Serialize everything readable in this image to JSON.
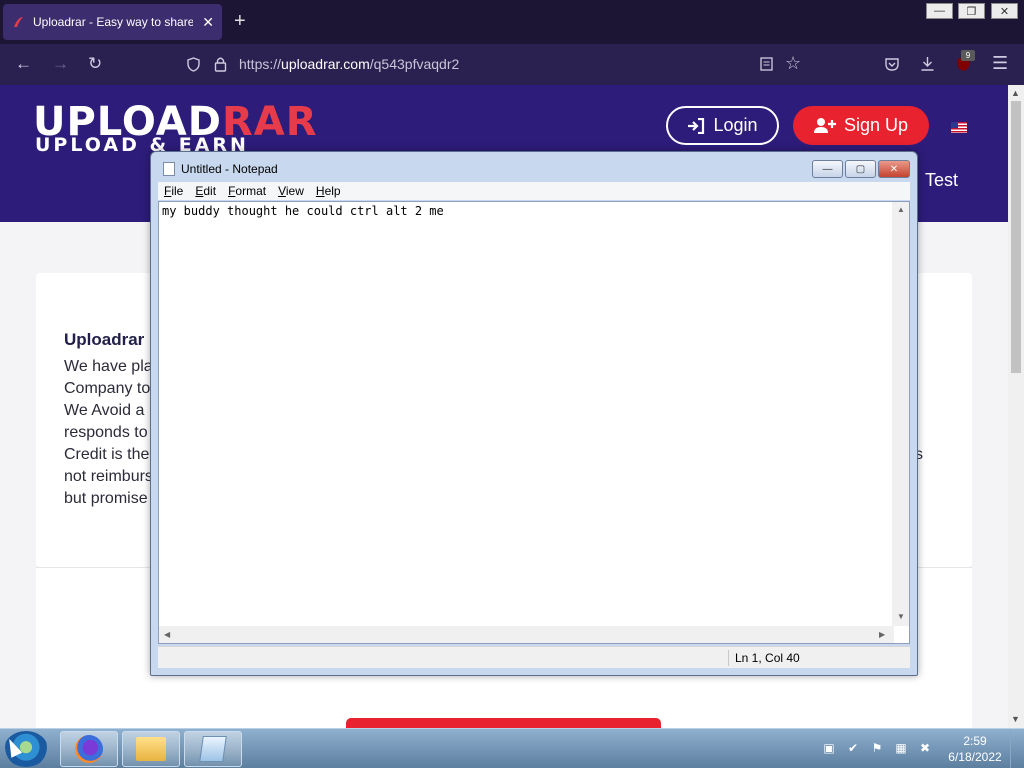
{
  "browser": {
    "tab_title": "Uploadrar - Easy way to share y",
    "tab_close": "✕",
    "new_tab": "+",
    "url_prefix": "https://",
    "url_host": "uploadrar.com",
    "url_path": "/q543pfvaqdr2",
    "extension_badge": "9",
    "window_controls": [
      "—",
      "❐",
      "✕"
    ]
  },
  "site": {
    "logo_main": "UPL",
    "logo_o": "O",
    "logo_ad": "AD",
    "logo_rar": "RAR",
    "logo_sub": "UPLOAD & EARN",
    "login_label": "Login",
    "signup_label": "Sign Up",
    "nav_partial": "Test",
    "card_title": "Uploadrar",
    "card_lines": [
      "We have pla",
      "Company to",
      "We Avoid a",
      "responds to",
      "Credit is the",
      "not reimburs",
      "but promise"
    ],
    "card_right_fragment": "s"
  },
  "notepad": {
    "title": "Untitled - Notepad",
    "menu": [
      "File",
      "Edit",
      "Format",
      "View",
      "Help"
    ],
    "content": "my buddy thought he could ctrl alt 2 me",
    "status_position": "Ln 1, Col 40"
  },
  "taskbar": {
    "time": "2:59",
    "date": "6/18/2022"
  },
  "colors": {
    "browser_bg": "#1c1533",
    "site_header": "#2d1c7a",
    "brand_red": "#e8222f"
  }
}
